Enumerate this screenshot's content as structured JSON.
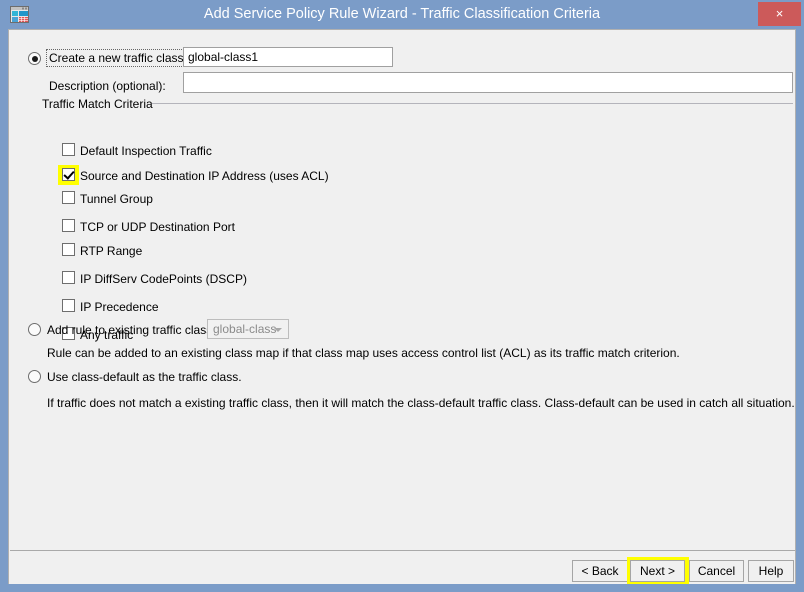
{
  "window": {
    "title": "Add Service Policy Rule Wizard - Traffic Classification Criteria",
    "icon": "app-window-icon",
    "close_label": "×",
    "titlebar_color": "#7b9cc8",
    "close_color": "#cc5a5a",
    "client_bg": "#f0f0f0",
    "highlight_color": "#ffff00"
  },
  "options": {
    "create_new": {
      "label": "Create a new traffic class:",
      "selected": true,
      "focused": true,
      "value": "global-class1",
      "placeholder": ""
    },
    "description": {
      "label": "Description (optional):",
      "value": "",
      "placeholder": ""
    },
    "add_existing": {
      "label": "Add rule to existing traffic class:",
      "selected": false,
      "combo_value": "global-class",
      "combo_enabled": false,
      "note": "Rule can be added to an existing class map if that class map uses access control list (ACL) as its traffic match criterion."
    },
    "class_default": {
      "label": "Use class-default as the traffic class.",
      "selected": false,
      "note": "If traffic does not match a existing traffic class, then it will match the class-default traffic class. Class-default can be used in catch all situation."
    }
  },
  "criteria_group": {
    "title": "Traffic Match Criteria",
    "items": [
      {
        "label": "Default Inspection Traffic",
        "checked": false,
        "highlighted": false
      },
      {
        "label": "Source and Destination IP Address (uses ACL)",
        "checked": true,
        "highlighted": true
      },
      {
        "label": "Tunnel Group",
        "checked": false,
        "highlighted": false
      },
      {
        "label": "TCP or UDP Destination Port",
        "checked": false,
        "highlighted": false
      },
      {
        "label": "RTP Range",
        "checked": false,
        "highlighted": false
      },
      {
        "label": "IP DiffServ CodePoints (DSCP)",
        "checked": false,
        "highlighted": false
      },
      {
        "label": "IP Precedence",
        "checked": false,
        "highlighted": false
      },
      {
        "label": "Any traffic",
        "checked": false,
        "highlighted": false
      }
    ]
  },
  "buttons": {
    "back": {
      "label": "< Back",
      "highlighted": false
    },
    "next": {
      "label": "Next >",
      "highlighted": true
    },
    "cancel": {
      "label": "Cancel",
      "highlighted": false
    },
    "help": {
      "label": "Help",
      "highlighted": false
    }
  }
}
